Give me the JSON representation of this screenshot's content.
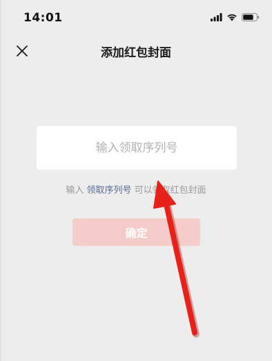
{
  "status_bar": {
    "time": "14:01",
    "icons": [
      "signal-icon",
      "wifi-icon",
      "battery-icon"
    ]
  },
  "nav": {
    "title": "添加红包封面",
    "close_icon": "close-icon"
  },
  "serial_input": {
    "placeholder": "输入领取序列号",
    "value": ""
  },
  "hint": {
    "prefix": "输入 ",
    "link": "领取序列号",
    "suffix": " 可以领取红包封面"
  },
  "confirm": {
    "label": "确定",
    "enabled": false
  },
  "colors": {
    "background": "#ededed",
    "link": "#576b95",
    "button_disabled": "#f4c9c6",
    "annotation_arrow": "#e8211a"
  }
}
